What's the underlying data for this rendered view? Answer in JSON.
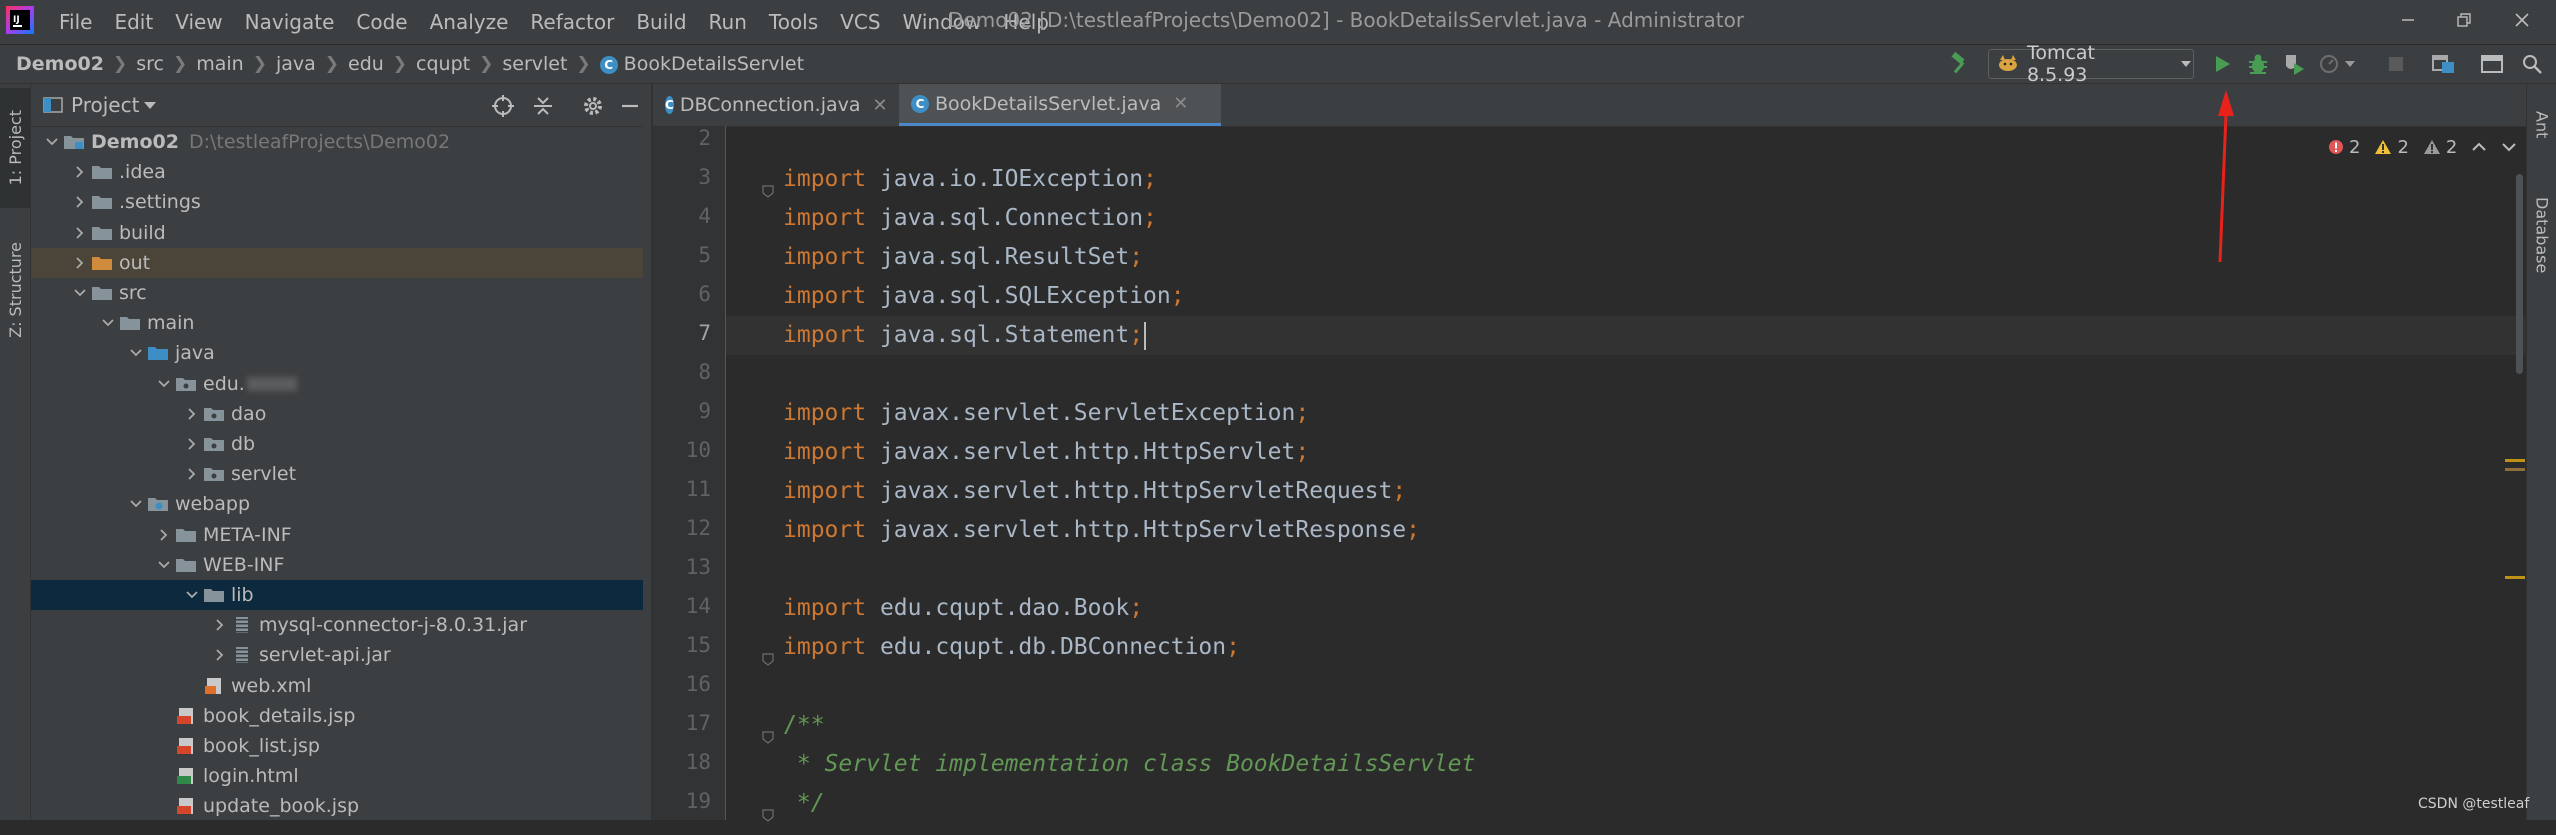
{
  "titlebar": {
    "menus": [
      "File",
      "Edit",
      "View",
      "Navigate",
      "Code",
      "Analyze",
      "Refactor",
      "Build",
      "Run",
      "Tools",
      "VCS",
      "Window",
      "Help"
    ],
    "window_title": "Demo02 [D:\\testleafProjects\\Demo02] - BookDetailsServlet.java - Administrator",
    "controls": [
      "minimize-icon",
      "restore-icon",
      "close-icon"
    ]
  },
  "navbar": {
    "breadcrumb": [
      "Demo02",
      "src",
      "main",
      "java",
      "edu",
      "cqupt",
      "servlet",
      "BookDetailsServlet"
    ],
    "class_badge": "C",
    "run_config": "Tomcat 8.5.93",
    "tools": [
      "build-hammer-icon",
      "run-icon",
      "debug-icon",
      "coverage-icon",
      "profile-icon",
      "stop-icon",
      "project-structure-icon",
      "layout-icon",
      "search-everywhere-icon"
    ]
  },
  "left_stripe": {
    "project_tab": "1: Project",
    "structure_tab": "Z: Structure"
  },
  "right_stripe": {
    "ant_tab": "Ant",
    "database_tab": "Database"
  },
  "project_panel": {
    "title": "Project",
    "tree": [
      {
        "label": "Demo02",
        "hint": "D:\\testleafProjects\\Demo02",
        "depth": 0,
        "expanded": true,
        "icon": "module-folder",
        "bold": true
      },
      {
        "label": ".idea",
        "depth": 1,
        "expanded": false,
        "icon": "folder"
      },
      {
        "label": ".settings",
        "depth": 1,
        "expanded": false,
        "icon": "folder"
      },
      {
        "label": "build",
        "depth": 1,
        "expanded": false,
        "icon": "folder"
      },
      {
        "label": "out",
        "depth": 1,
        "expanded": false,
        "icon": "excluded-folder",
        "highlight": "out"
      },
      {
        "label": "src",
        "depth": 1,
        "expanded": true,
        "icon": "folder"
      },
      {
        "label": "main",
        "depth": 2,
        "expanded": true,
        "icon": "folder"
      },
      {
        "label": "java",
        "depth": 3,
        "expanded": true,
        "icon": "source-folder"
      },
      {
        "label": "edu.",
        "depth": 4,
        "expanded": true,
        "icon": "package",
        "blurred": true
      },
      {
        "label": "dao",
        "depth": 5,
        "expanded": false,
        "icon": "package"
      },
      {
        "label": "db",
        "depth": 5,
        "expanded": false,
        "icon": "package"
      },
      {
        "label": "servlet",
        "depth": 5,
        "expanded": false,
        "icon": "package"
      },
      {
        "label": "webapp",
        "depth": 3,
        "expanded": true,
        "icon": "web-folder"
      },
      {
        "label": "META-INF",
        "depth": 4,
        "expanded": false,
        "icon": "folder"
      },
      {
        "label": "WEB-INF",
        "depth": 4,
        "expanded": true,
        "icon": "folder"
      },
      {
        "label": "lib",
        "depth": 5,
        "expanded": true,
        "icon": "folder",
        "selected": true
      },
      {
        "label": "mysql-connector-j-8.0.31.jar",
        "depth": 6,
        "expanded": false,
        "icon": "jar"
      },
      {
        "label": "servlet-api.jar",
        "depth": 6,
        "expanded": false,
        "icon": "jar"
      },
      {
        "label": "web.xml",
        "depth": 5,
        "icon": "xml"
      },
      {
        "label": "book_details.jsp",
        "depth": 4,
        "icon": "jsp"
      },
      {
        "label": "book_list.jsp",
        "depth": 4,
        "icon": "jsp"
      },
      {
        "label": "login.html",
        "depth": 4,
        "icon": "html"
      },
      {
        "label": "update_book.jsp",
        "depth": 4,
        "icon": "jsp"
      }
    ]
  },
  "editor": {
    "tabs": [
      {
        "label": "DBConnection.java",
        "active": false
      },
      {
        "label": "BookDetailsServlet.java",
        "active": true
      }
    ],
    "inspections": {
      "errors": "2",
      "warnings": "2",
      "weak_warnings": "2"
    },
    "current_line": 7,
    "lines": [
      {
        "num": "2",
        "tokens": []
      },
      {
        "num": "3",
        "tokens": [
          [
            "kw",
            "import"
          ],
          [
            "pkg",
            " java.io.IOException"
          ],
          [
            "semi",
            ";"
          ]
        ],
        "fold": true
      },
      {
        "num": "4",
        "tokens": [
          [
            "kw",
            "import"
          ],
          [
            "pkg",
            " java.sql.Connection"
          ],
          [
            "semi",
            ";"
          ]
        ]
      },
      {
        "num": "5",
        "tokens": [
          [
            "kw",
            "import"
          ],
          [
            "pkg",
            " java.sql.ResultSet"
          ],
          [
            "semi",
            ";"
          ]
        ]
      },
      {
        "num": "6",
        "tokens": [
          [
            "kw",
            "import"
          ],
          [
            "pkg",
            " java.sql.SQLException"
          ],
          [
            "semi",
            ";"
          ]
        ]
      },
      {
        "num": "7",
        "tokens": [
          [
            "kw",
            "import"
          ],
          [
            "pkg",
            " java.sql.Statement"
          ],
          [
            "semi",
            ";"
          ]
        ]
      },
      {
        "num": "8",
        "tokens": []
      },
      {
        "num": "9",
        "tokens": [
          [
            "kw",
            "import"
          ],
          [
            "pkg",
            " javax.servlet.ServletException"
          ],
          [
            "semi",
            ";"
          ]
        ]
      },
      {
        "num": "10",
        "tokens": [
          [
            "kw",
            "import"
          ],
          [
            "pkg",
            " javax.servlet.http.HttpServlet"
          ],
          [
            "semi",
            ";"
          ]
        ]
      },
      {
        "num": "11",
        "tokens": [
          [
            "kw",
            "import"
          ],
          [
            "pkg",
            " javax.servlet.http.HttpServletRequest"
          ],
          [
            "semi",
            ";"
          ]
        ]
      },
      {
        "num": "12",
        "tokens": [
          [
            "kw",
            "import"
          ],
          [
            "pkg",
            " javax.servlet.http.HttpServletResponse"
          ],
          [
            "semi",
            ";"
          ]
        ]
      },
      {
        "num": "13",
        "tokens": []
      },
      {
        "num": "14",
        "tokens": [
          [
            "kw",
            "import"
          ],
          [
            "pkg",
            " edu.cqupt.dao.Book"
          ],
          [
            "semi",
            ";"
          ]
        ]
      },
      {
        "num": "15",
        "tokens": [
          [
            "kw",
            "import"
          ],
          [
            "pkg",
            " edu.cqupt.db.DBConnection"
          ],
          [
            "semi",
            ";"
          ]
        ],
        "fold": true
      },
      {
        "num": "16",
        "tokens": []
      },
      {
        "num": "17",
        "tokens": [
          [
            "cmt-plain",
            "/**"
          ]
        ],
        "fold": true
      },
      {
        "num": "18",
        "tokens": [
          [
            "cmt",
            " * Servlet implementation class BookDetailsServlet"
          ]
        ]
      },
      {
        "num": "19",
        "tokens": [
          [
            "cmt",
            " */"
          ]
        ],
        "fold": true
      }
    ]
  },
  "colors": {
    "keyword": "#cc7832",
    "comment": "#629755",
    "accent": "#4a88c7",
    "annotation_arrow": "#e8221b",
    "run_green": "#499c54"
  },
  "watermark": "CSDN @testleaf"
}
